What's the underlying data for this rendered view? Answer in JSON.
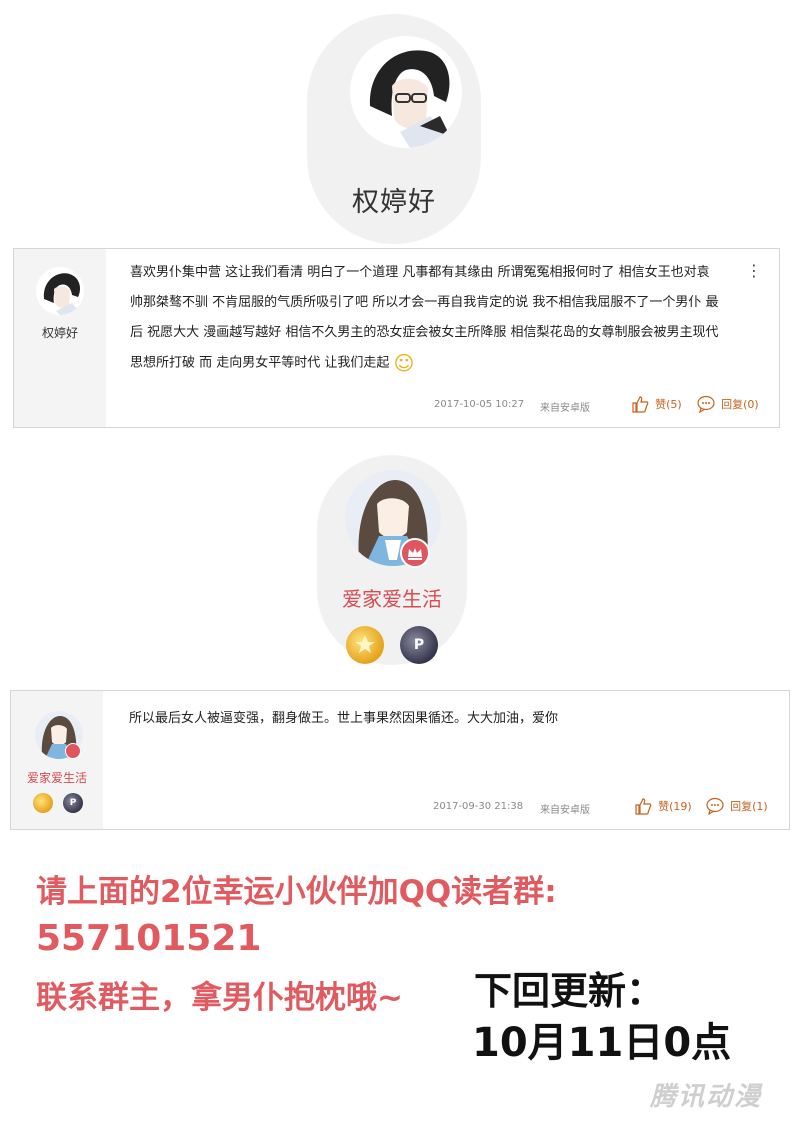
{
  "profile1": {
    "name": "权婷好"
  },
  "comment1": {
    "author": "权婷好",
    "lines": [
      "喜欢男仆集中营  这让我们看清  明白了一个道理  凡事都有其缘由  所谓冤冤相报何时了  相信女王也对袁",
      "帅那桀骜不驯  不肯屈服的气质所吸引了吧  所以才会一再自我肯定的说  我不相信我屈服不了一个男仆  最",
      "后  祝愿大大  漫画越写越好  相信不久男主的恐女症会被女主所降服  相信梨花岛的女尊制服会被男主现代",
      "思想所打破  而  走向男女平等时代  让我们走起"
    ],
    "emoji": "☺",
    "date": "2017-10-05  10:27",
    "source": "来自安卓版",
    "like_label": "赞(5)",
    "reply_label": "回复(0)",
    "more_icon": "⋮"
  },
  "profile2": {
    "name": "爱家爱生活",
    "medal_p": "P"
  },
  "comment2": {
    "author": "爱家爱生活",
    "text": "所以最后女人被逼变强，翻身做王。世上事果然因果循还。大大加油，爱你",
    "date": "2017-09-30  21:38",
    "source": "来自安卓版",
    "like_label": "赞(19)",
    "reply_label": "回复(1)",
    "medal_p": "P"
  },
  "promo": {
    "line1": "请上面的2位幸运小伙伴加QQ读者群:",
    "line2": "557101521",
    "line3": "联系群主，拿男仆抱枕哦~"
  },
  "next_update": {
    "line1": "下回更新：",
    "line2": "10月11日0点"
  },
  "watermark": "腾讯动漫",
  "colors": {
    "accent": "#e15a5f",
    "action": "#c7621f"
  }
}
